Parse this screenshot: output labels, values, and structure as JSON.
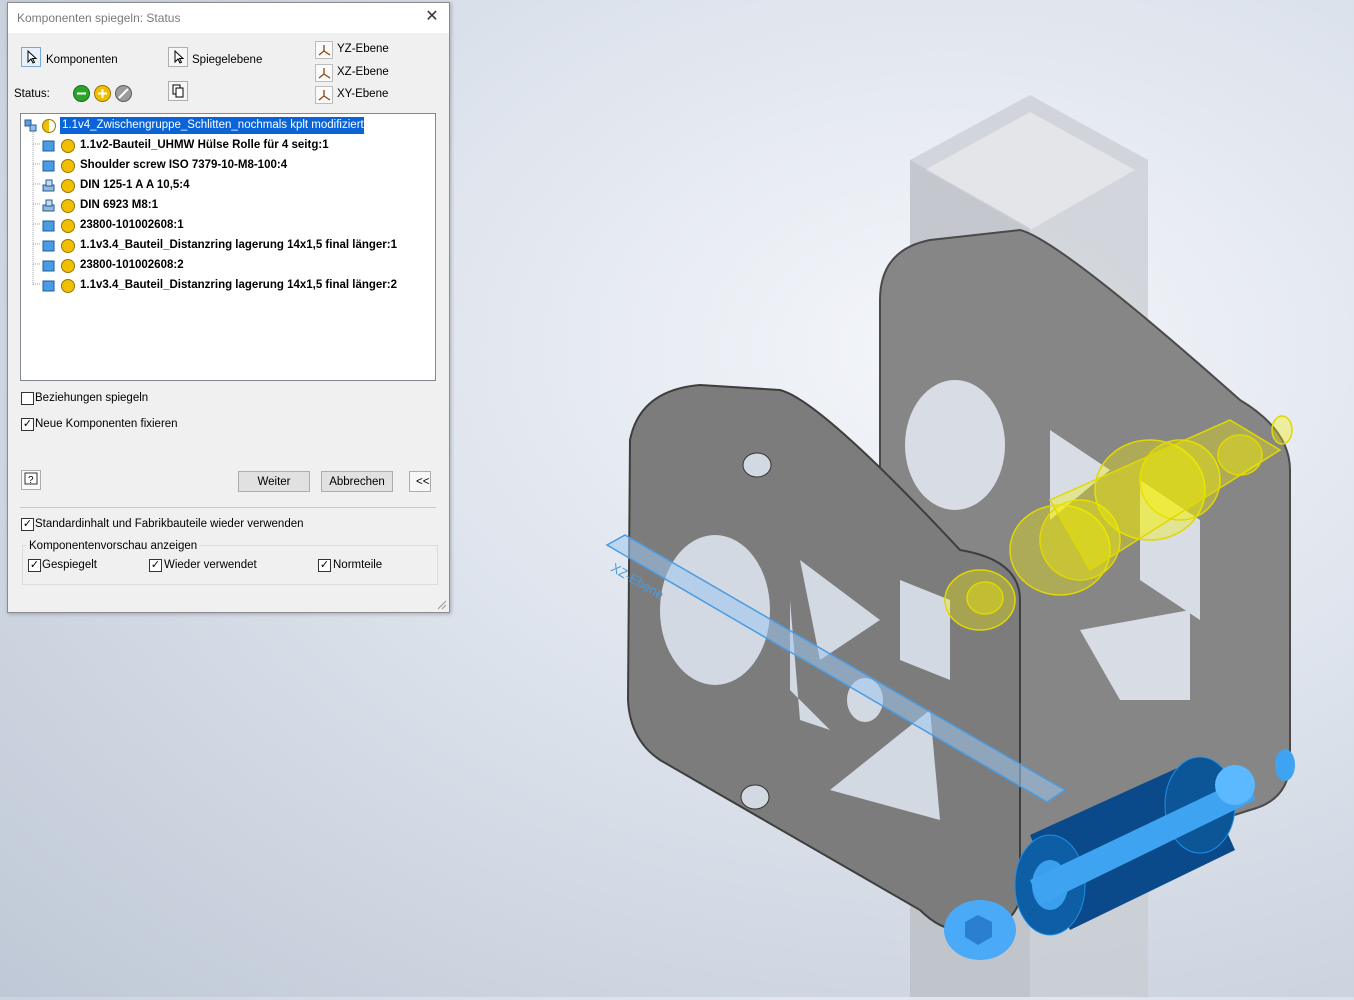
{
  "dialog": {
    "title": "Komponenten spiegeln: Status",
    "components_label": "Komponenten",
    "mirror_plane_label": "Spiegelebene",
    "planes": [
      "YZ-Ebene",
      "XZ-Ebene",
      "XY-Ebene"
    ],
    "status_label": "Status:",
    "tree": {
      "root": "1.1v4_Zwischengruppe_Schlitten_nochmals kplt modifiziert.iam",
      "items": [
        {
          "label": "1.1v2-Bauteil_UHMW Hülse Rolle für 4 seitg:1",
          "icon": "part-icon"
        },
        {
          "label": "Shoulder screw ISO 7379-10-M8-100:4",
          "icon": "part-icon"
        },
        {
          "label": "DIN 125-1 A A 10,5:4",
          "icon": "library-part-icon"
        },
        {
          "label": "DIN 6923 M8:1",
          "icon": "library-part-icon"
        },
        {
          "label": "23800-101002608:1",
          "icon": "part-icon"
        },
        {
          "label": "1.1v3.4_Bauteil_Distanzring lagerung 14x1,5 final länger:1",
          "icon": "part-icon"
        },
        {
          "label": "23800-101002608:2",
          "icon": "part-icon"
        },
        {
          "label": "1.1v3.4_Bauteil_Distanzring lagerung 14x1,5 final länger:2",
          "icon": "part-icon"
        }
      ]
    },
    "check_mirror_relations": "Beziehungen spiegeln",
    "check_fix_new": "Neue Komponenten fixieren",
    "btn_next": "Weiter",
    "btn_cancel": "Abbrechen",
    "btn_collapse": "<<",
    "check_reuse": "Standardinhalt und Fabrikbauteile wieder verwenden",
    "preview_group": "Komponentenvorschau anzeigen",
    "preview_checks": [
      "Gespiegelt",
      "Wieder verwendet",
      "Normteile"
    ]
  },
  "viewport": {
    "plane_label": "XZ-Ebene"
  },
  "colors": {
    "selection": "#0a64d8",
    "highlight_yellow": "#f5f000",
    "preview_blue": "#1e90e6"
  }
}
